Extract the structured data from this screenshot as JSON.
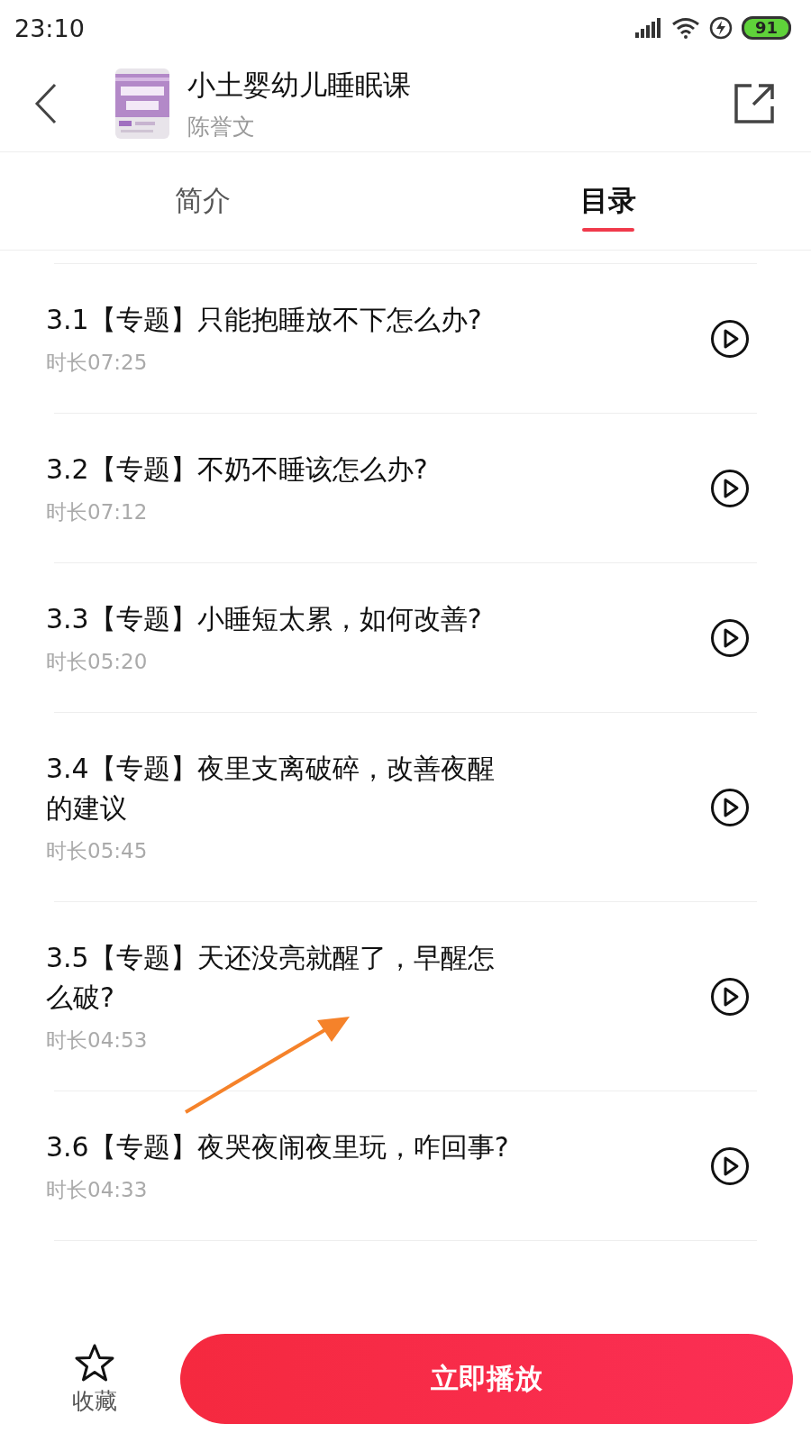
{
  "status_bar": {
    "time": "23:10",
    "battery": "91"
  },
  "header": {
    "title": "小土婴幼儿睡眠课",
    "author": "陈誉文"
  },
  "tabs": [
    {
      "label": "简介",
      "selected": false
    },
    {
      "label": "目录",
      "selected": true
    }
  ],
  "episodes": [
    {
      "title": "3.1【专题】只能抱睡放不下怎么办?",
      "duration": "时长07:25"
    },
    {
      "title": "3.2【专题】不奶不睡该怎么办?",
      "duration": "时长07:12"
    },
    {
      "title": "3.3【专题】小睡短太累，如何改善?",
      "duration": "时长05:20"
    },
    {
      "title": "3.4【专题】夜里支离破碎，改善夜醒的建议",
      "duration": "时长05:45"
    },
    {
      "title": "3.5【专题】天还没亮就醒了，早醒怎么破?",
      "duration": "时长04:53"
    },
    {
      "title": "3.6【专题】夜哭夜闹夜里玩，咋回事?",
      "duration": "时长04:33"
    }
  ],
  "bottom_bar": {
    "favorite_label": "收藏",
    "play_button": "立即播放"
  }
}
